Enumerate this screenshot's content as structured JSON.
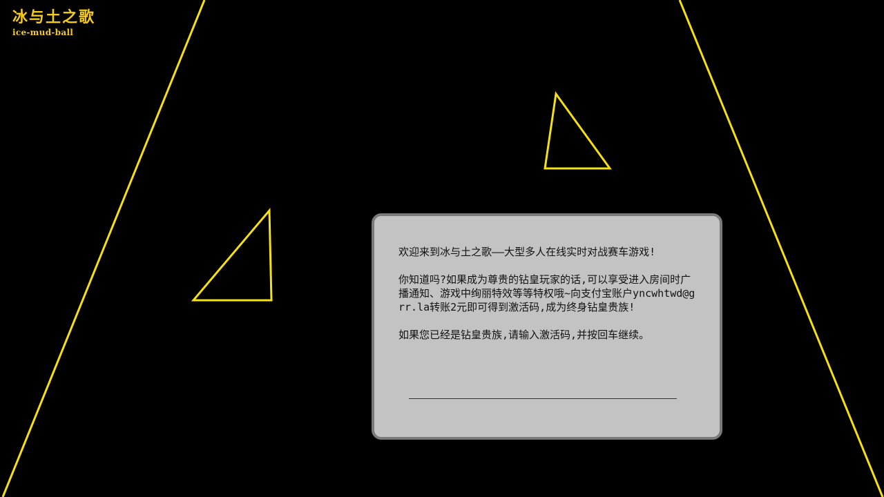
{
  "logo": {
    "title": "冰与土之歌",
    "subtitle": "ice-mud-ball"
  },
  "dialog": {
    "welcome": "欢迎来到冰与土之歌——大型多人在线实时对战赛车游戏!",
    "promo": "你知道吗?如果成为尊贵的钻皇玩家的话,可以享受进入房间时广播通知、游戏中绚丽特效等等特权哦~向支付宝账户yncwhtwd@grr.la转账2元即可得到激活码,成为终身钻皇贵族!",
    "instruction": "如果您已经是钻皇贵族,请输入激活码,并按回车继续。",
    "activation_value": ""
  },
  "colors": {
    "accent_yellow": "#f5e010",
    "logo_gold": "#f5cc1b",
    "dialog_bg": "#c3c3c3",
    "dialog_border": "#7a7a7a"
  }
}
